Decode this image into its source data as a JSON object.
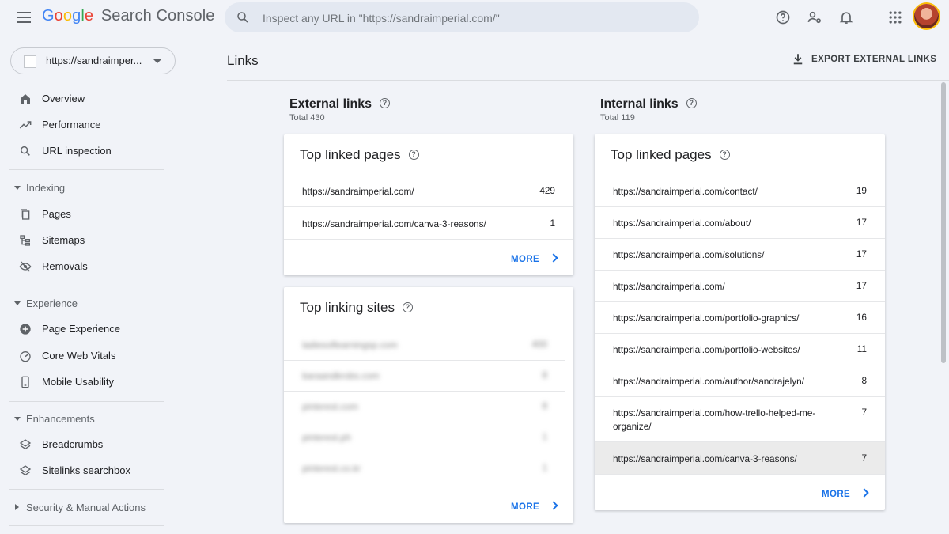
{
  "app": {
    "title_google": [
      "G",
      "o",
      "o",
      "g",
      "l",
      "e"
    ],
    "title_product": "Search Console"
  },
  "search": {
    "placeholder": "Inspect any URL in \"https://sandraimperial.com/\""
  },
  "property": {
    "label": "https://sandraimper..."
  },
  "sidebar": {
    "items_top": [
      {
        "label": "Overview",
        "icon": "home-icon"
      },
      {
        "label": "Performance",
        "icon": "trending-up-icon"
      },
      {
        "label": "URL inspection",
        "icon": "search-icon"
      }
    ],
    "sections": [
      {
        "label": "Indexing",
        "items": [
          {
            "label": "Pages",
            "icon": "pages-icon"
          },
          {
            "label": "Sitemaps",
            "icon": "sitemap-icon"
          },
          {
            "label": "Removals",
            "icon": "eye-off-icon"
          }
        ]
      },
      {
        "label": "Experience",
        "items": [
          {
            "label": "Page Experience",
            "icon": "plus-circle-icon"
          },
          {
            "label": "Core Web Vitals",
            "icon": "gauge-icon"
          },
          {
            "label": "Mobile Usability",
            "icon": "phone-icon"
          }
        ]
      },
      {
        "label": "Enhancements",
        "items": [
          {
            "label": "Breadcrumbs",
            "icon": "layers-icon"
          },
          {
            "label": "Sitelinks searchbox",
            "icon": "layers-icon"
          }
        ]
      },
      {
        "label": "Security & Manual Actions",
        "items": []
      }
    ]
  },
  "main": {
    "title": "Links",
    "export_label": "EXPORT EXTERNAL LINKS",
    "external": {
      "heading": "External links",
      "total": "Total 430",
      "top_linked_pages": {
        "title": "Top linked pages",
        "rows": [
          {
            "url": "https://sandraimperial.com/",
            "value": "429"
          },
          {
            "url": "https://sandraimperial.com/canva-3-reasons/",
            "value": "1"
          }
        ],
        "more": "MORE"
      },
      "top_linking_sites": {
        "title": "Top linking sites",
        "rows": [
          {
            "url": "ladiesoflearningsp.com",
            "value": "400"
          },
          {
            "url": "baraandkrobs.com",
            "value": "8"
          },
          {
            "url": "pinterest.com",
            "value": "8"
          },
          {
            "url": "pinterest.ph",
            "value": "1"
          },
          {
            "url": "pinterest.co.kr",
            "value": "1"
          }
        ],
        "more": "MORE"
      }
    },
    "internal": {
      "heading": "Internal links",
      "total": "Total 119",
      "top_linked_pages": {
        "title": "Top linked pages",
        "rows": [
          {
            "url": "https://sandraimperial.com/contact/",
            "value": "19"
          },
          {
            "url": "https://sandraimperial.com/about/",
            "value": "17"
          },
          {
            "url": "https://sandraimperial.com/solutions/",
            "value": "17"
          },
          {
            "url": "https://sandraimperial.com/",
            "value": "17"
          },
          {
            "url": "https://sandraimperial.com/portfolio-graphics/",
            "value": "16"
          },
          {
            "url": "https://sandraimperial.com/portfolio-websites/",
            "value": "11"
          },
          {
            "url": "https://sandraimperial.com/author/sandrajelyn/",
            "value": "8"
          },
          {
            "url": "https://sandraimperial.com/how-trello-helped-me-organize/",
            "value": "7"
          },
          {
            "url": "https://sandraimperial.com/canva-3-reasons/",
            "value": "7"
          }
        ],
        "more": "MORE"
      }
    }
  },
  "colors": {
    "accent": "#1a73e8",
    "background": "#f1f3f8",
    "search_bg": "#e3e8f1"
  }
}
